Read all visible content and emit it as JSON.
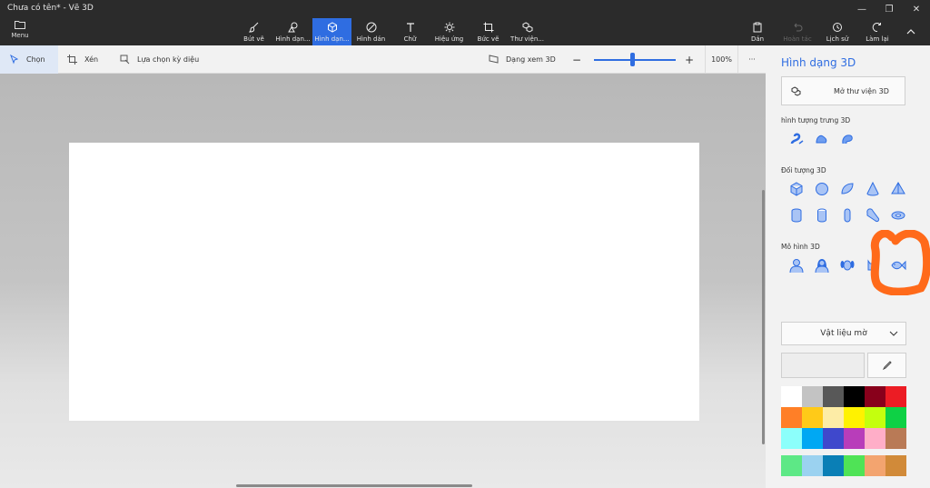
{
  "window": {
    "title": "Chưa có tên* - Vẽ 3D",
    "controls": [
      "minimize-icon",
      "restore-icon",
      "close-icon"
    ]
  },
  "menu": {
    "label": "Menu"
  },
  "toolbar": {
    "tools": [
      {
        "label": "Bút vẽ",
        "icon": "brush-icon"
      },
      {
        "label": "Hình dạn...",
        "icon": "2d-shapes-icon"
      },
      {
        "label": "Hình dạn...",
        "icon": "3d-shapes-icon",
        "active": true
      },
      {
        "label": "Hình dán",
        "icon": "sticker-icon"
      },
      {
        "label": "Chữ",
        "icon": "text-icon"
      },
      {
        "label": "Hiệu ứng",
        "icon": "effects-icon"
      },
      {
        "label": "Bức vẽ",
        "icon": "canvas-icon"
      },
      {
        "label": "Thư viện...",
        "icon": "library-icon"
      }
    ],
    "right": [
      {
        "label": "Dán",
        "icon": "paste-icon"
      },
      {
        "label": "Hoàn tác",
        "icon": "undo-icon",
        "disabled": true
      },
      {
        "label": "Lịch sử",
        "icon": "history-icon"
      },
      {
        "label": "Làm lại",
        "icon": "redo-icon"
      }
    ]
  },
  "subbar": {
    "select": "Chọn",
    "crop": "Xén",
    "magic_select": "Lựa chọn kỳ diệu",
    "view_3d": "Dạng xem 3D",
    "zoom": "100%",
    "zoom_fraction": 0.47,
    "more": "···"
  },
  "panel": {
    "title": "Hình dạng 3D",
    "open_library": "Mở thư viện 3D",
    "doodles_label": "hình tượng trưng 3D",
    "objects_label": "Đối tượng 3D",
    "models_label": "Mô hình 3D",
    "material": "Vật liệu mờ",
    "doodles": [
      "sharp-doodle-icon",
      "soft-doodle-icon",
      "tube-doodle-icon"
    ],
    "objects_row1": [
      "cube-icon",
      "sphere-icon",
      "hemisphere-icon",
      "cone-icon",
      "pyramid-icon"
    ],
    "objects_row2": [
      "cylinder-icon",
      "tube-icon",
      "capsule-icon",
      "curved-tube-icon",
      "donut-icon"
    ],
    "models": [
      "man-icon",
      "woman-icon",
      "dog-icon",
      "cat-icon",
      "fish-icon"
    ],
    "colors_row_main": [
      "#ffffff",
      "#c3c3c3",
      "#585858",
      "#000000",
      "#88001b",
      "#ec1c24",
      "#ff7f27",
      "#ffca18",
      "#fdeca6",
      "#fff200",
      "#c4ff0e",
      "#0ed145",
      "#8cfffb",
      "#00a8f3",
      "#3f48cc",
      "#b83dba",
      "#ffaec8",
      "#b97a56"
    ],
    "colors_row_extra": [
      "#5de886",
      "#9bd2f0",
      "#0a7fb6",
      "#4fe356",
      "#f3a46f",
      "#d18a39"
    ]
  },
  "accent": "#2f6de1",
  "annotation_color": "#ff6a1a"
}
